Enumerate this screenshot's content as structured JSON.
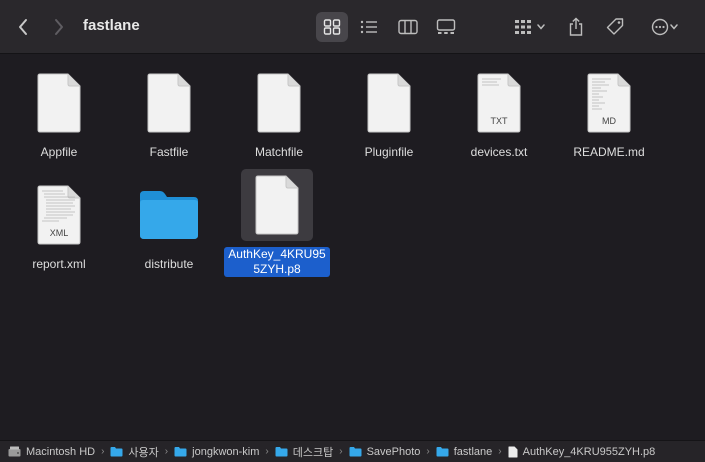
{
  "window": {
    "title": "fastlane"
  },
  "colors": {
    "selection": "#1c5fcc",
    "folder": "#35a8ea",
    "background": "#1e1c21"
  },
  "files": [
    {
      "name": "Appfile",
      "type": "document",
      "badge": ""
    },
    {
      "name": "Fastfile",
      "type": "document",
      "badge": ""
    },
    {
      "name": "Matchfile",
      "type": "document",
      "badge": ""
    },
    {
      "name": "Pluginfile",
      "type": "document",
      "badge": ""
    },
    {
      "name": "devices.txt",
      "type": "text",
      "badge": "TXT"
    },
    {
      "name": "README.md",
      "type": "text",
      "badge": "MD"
    },
    {
      "name": "report.xml",
      "type": "text",
      "badge": "XML"
    },
    {
      "name": "distribute",
      "type": "folder",
      "badge": ""
    },
    {
      "name": "AuthKey_4KRU955ZYH.p8",
      "type": "document",
      "badge": "",
      "selected": true
    }
  ],
  "pathbar": {
    "crumbs": [
      "Macintosh HD",
      "사용자",
      "jongkwon-kim",
      "데스크탑",
      "SavePhoto",
      "fastlane",
      "AuthKey_4KRU955ZYH.p8"
    ]
  }
}
